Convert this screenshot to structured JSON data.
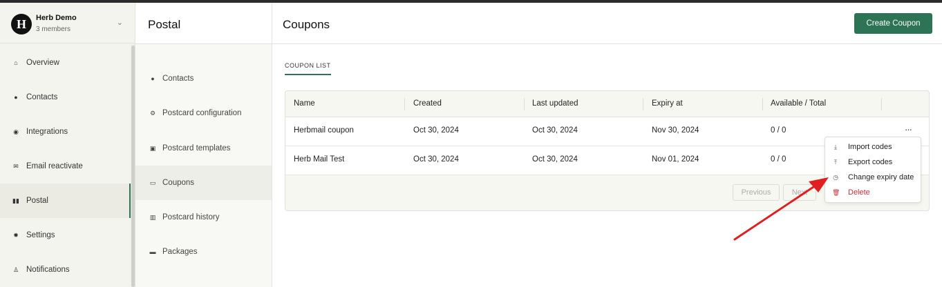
{
  "org": {
    "logo_letter": "H",
    "name": "Herb Demo",
    "members": "3 members"
  },
  "sidebar": {
    "items": [
      {
        "label": "Overview",
        "icon": "home-icon"
      },
      {
        "label": "Contacts",
        "icon": "person-icon"
      },
      {
        "label": "Integrations",
        "icon": "integrations-icon"
      },
      {
        "label": "Email reactivate",
        "icon": "email-icon"
      },
      {
        "label": "Postal",
        "icon": "postal-icon",
        "active": true
      },
      {
        "label": "Settings",
        "icon": "gear-icon"
      },
      {
        "label": "Notifications",
        "icon": "bell-icon"
      }
    ]
  },
  "postal": {
    "title": "Postal",
    "items": [
      {
        "label": "Contacts",
        "icon": "person-icon"
      },
      {
        "label": "Postcard configuration",
        "icon": "postcard-config-icon"
      },
      {
        "label": "Postcard templates",
        "icon": "template-icon"
      },
      {
        "label": "Coupons",
        "icon": "coupon-icon",
        "active": true
      },
      {
        "label": "Postcard history",
        "icon": "history-icon"
      },
      {
        "label": "Packages",
        "icon": "package-icon"
      }
    ]
  },
  "main": {
    "title": "Coupons",
    "create_label": "Create Coupon",
    "tab_label": "COUPON LIST",
    "columns": [
      "Name",
      "Created",
      "Last updated",
      "Expiry at",
      "Available / Total"
    ],
    "rows": [
      {
        "name": "Herbmail coupon",
        "created": "Oct 30, 2024",
        "updated": "Oct 30, 2024",
        "expiry": "Nov 30, 2024",
        "available": "0 / 0"
      },
      {
        "name": "Herb Mail Test",
        "created": "Oct 30, 2024",
        "updated": "Oct 30, 2024",
        "expiry": "Nov 01, 2024",
        "available": "0 / 0"
      }
    ],
    "row_menu_glyph": "···",
    "pager": {
      "previous": "Previous",
      "next": "Next"
    }
  },
  "menu": {
    "items": [
      {
        "label": "Import codes",
        "icon": "import-icon"
      },
      {
        "label": "Export codes",
        "icon": "export-icon"
      },
      {
        "label": "Change expiry date",
        "icon": "calendar-icon"
      },
      {
        "label": "Delete",
        "icon": "trash-icon",
        "danger": true
      }
    ]
  },
  "colors": {
    "accent": "#2d7356",
    "danger": "#c0303a",
    "annotation": "#e02020"
  }
}
